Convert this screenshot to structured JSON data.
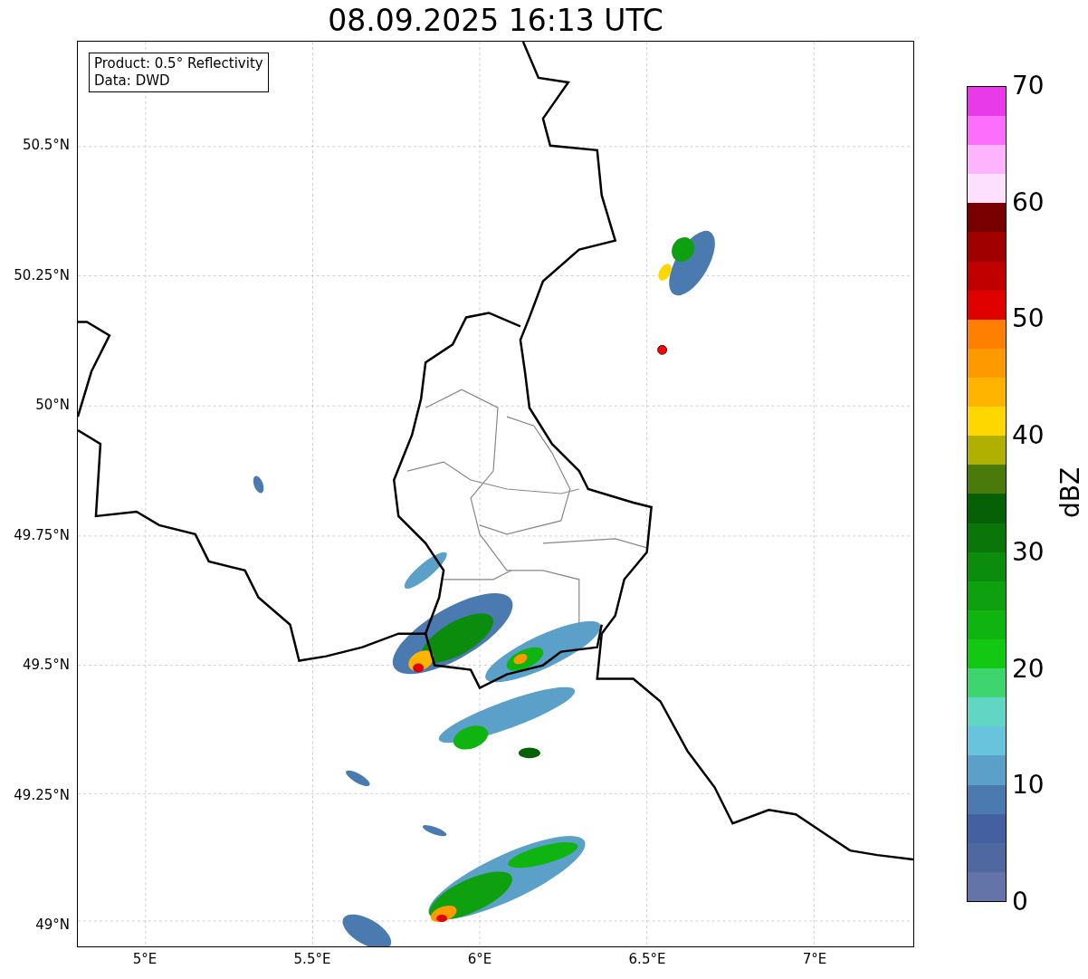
{
  "title": "08.09.2025 16:13 UTC",
  "legend": [
    "Product: 0.5° Reflectivity",
    "Data: DWD"
  ],
  "x_ticks": [
    "5°E",
    "5.5°E",
    "6°E",
    "6.5°E",
    "7°E"
  ],
  "y_ticks": [
    "50.5°N",
    "50.25°N",
    "50°N",
    "49.75°N",
    "49.5°N",
    "49.25°N",
    "49°N"
  ],
  "colorbar": {
    "label": "dBZ",
    "ticks": [
      "70",
      "60",
      "50",
      "40",
      "30",
      "20",
      "10",
      "0"
    ],
    "bands": [
      {
        "color": "#6474a8"
      },
      {
        "color": "#5068a0"
      },
      {
        "color": "#4460a0"
      },
      {
        "color": "#4a7ab0"
      },
      {
        "color": "#5aa0c8"
      },
      {
        "color": "#68c4dc"
      },
      {
        "color": "#62d6c4"
      },
      {
        "color": "#3ed46e"
      },
      {
        "color": "#12c812"
      },
      {
        "color": "#10b410"
      },
      {
        "color": "#0ea00e"
      },
      {
        "color": "#0c8c0c"
      },
      {
        "color": "#0a760a"
      },
      {
        "color": "#066006"
      },
      {
        "color": "#4a7a0a"
      },
      {
        "color": "#b0b000"
      },
      {
        "color": "#ffd700"
      },
      {
        "color": "#ffb400"
      },
      {
        "color": "#ff9900"
      },
      {
        "color": "#ff7f00"
      },
      {
        "color": "#e00000"
      },
      {
        "color": "#c00000"
      },
      {
        "color": "#a00000"
      },
      {
        "color": "#780000"
      },
      {
        "color": "#fde0fd"
      },
      {
        "color": "#fdb4fd"
      },
      {
        "color": "#fd6efd"
      },
      {
        "color": "#e93ae9"
      }
    ]
  }
}
